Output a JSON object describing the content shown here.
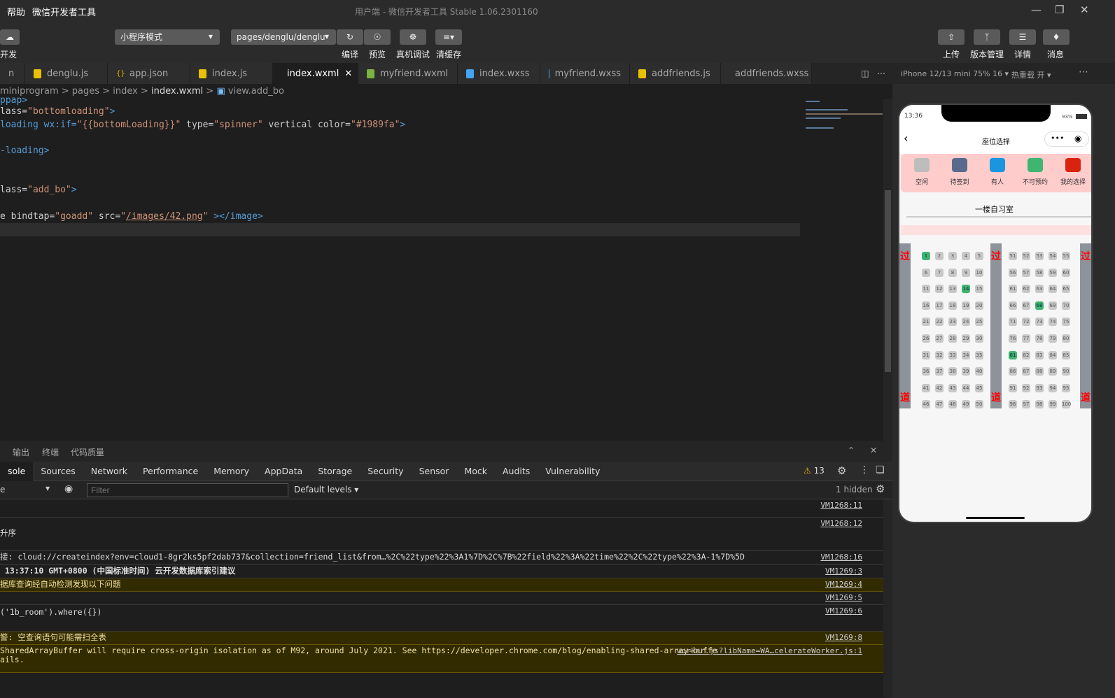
{
  "titlebar": {
    "menu": [
      "帮助",
      "微信开发者工具"
    ],
    "title": "用户端 - 微信开发者工具 Stable 1.06.2301160"
  },
  "toolbar": {
    "left_label": "开发",
    "mode": "小程序模式",
    "page_path": "pages/denglu/denglu",
    "compile": "编译",
    "preview": "预览",
    "remote_debug": "真机调试",
    "clear_cache": "清缓存",
    "upload": "上传",
    "version": "版本管理",
    "details": "详情",
    "messages": "消息"
  },
  "tabs": [
    {
      "label": "n",
      "type": "json"
    },
    {
      "label": "denglu.js",
      "type": "js"
    },
    {
      "label": "app.json",
      "type": "json"
    },
    {
      "label": "index.js",
      "type": "js"
    },
    {
      "label": "index.wxml",
      "type": "wxml",
      "active": true
    },
    {
      "label": "myfriend.wxml",
      "type": "wxml"
    },
    {
      "label": "index.wxss",
      "type": "wxss"
    },
    {
      "label": "myfriend.wxss",
      "type": "wxss"
    },
    {
      "label": "addfriends.js",
      "type": "js"
    },
    {
      "label": "addfriends.wxss",
      "type": "wxss"
    }
  ],
  "breadcrumb": [
    "miniprogram",
    "pages",
    "index",
    "index.wxml",
    "view.add_bo"
  ],
  "code": {
    "l0": "ppap>",
    "l1a": "lass=",
    "l1b": "\"bottomloading\"",
    "l1c": ">",
    "l2a": "loading wx:if=",
    "l2b": "\"{{bottomLoading}}\"",
    "l2c": " type=",
    "l2d": "\"spinner\"",
    "l2e": " vertical color=",
    "l2f": "\"#1989fa\"",
    "l2g": ">",
    "l3": "-loading>",
    "l4a": "lass=",
    "l4b": "\"add_bo\"",
    "l4c": ">",
    "l5a": "e bindtap=",
    "l5b": "\"goadd\"",
    "l5c": " src=",
    "l5d": "\"",
    "l5e": "/images/42.png",
    "l5f": "\"",
    "l5g": " ></image>"
  },
  "panel": {
    "tabs": [
      "输出",
      "终端",
      "代码质量"
    ],
    "devtools_tabs": [
      "sole",
      "Sources",
      "Network",
      "Performance",
      "Memory",
      "AppData",
      "Storage",
      "Security",
      "Sensor",
      "Mock",
      "Audits",
      "Vulnerability"
    ],
    "warnings": "13",
    "context": "e",
    "filter_placeholder": "Filter",
    "levels": "Default levels",
    "hidden": "1 hidden"
  },
  "console": [
    {
      "text": "",
      "src": "VM1268:11",
      "warn": false
    },
    {
      "text": "升序",
      "src": "VM1268:12",
      "warn": false
    },
    {
      "text": "接: cloud://createindex?env=cloud1-8gr2ks5pf2dab737&collection=friend_list&from…%2C%22type%22%3A1%7D%2C%7B%22field%22%3A%22time%22%2C%22type%22%3A-1%7D%5D",
      "src": "VM1268:16",
      "warn": false
    },
    {
      "text": " 13:37:10 GMT+0800 (中国标准时间) 云开发数据库索引建议",
      "src": "VM1269:3",
      "warn": false
    },
    {
      "text": "据库查询经自动检测发现以下问题",
      "src": "VM1269:4",
      "warn": true
    },
    {
      "text": "",
      "src": "VM1269:5",
      "warn": false
    },
    {
      "text": "('1b_room').where({})",
      "src": "VM1269:6",
      "warn": false
    },
    {
      "text": "警: 空查询语句可能需扫全表",
      "src": "VM1269:8",
      "warn": true
    },
    {
      "text": "SharedArrayBuffer will require cross-origin isolation as of M92, around July 2021. See https://developer.chrome.com/blog/enabling-shared-array-buffe\nails.",
      "src": "worker.js?libName=WA…celerateWorker.js:1",
      "warn": true
    }
  ],
  "simulator": {
    "device": "iPhone 12/13 mini 75% 16 ▾",
    "hot_reload": "热重载 开 ▾",
    "time": "13:36",
    "battery": "93%",
    "nav_title": "座位选择",
    "legend": [
      {
        "label": "空闲",
        "color": "#bdbdbd"
      },
      {
        "label": "待签到",
        "color": "#5a6a8c"
      },
      {
        "label": "有人",
        "color": "#1a96e0"
      },
      {
        "label": "不可预约",
        "color": "#3fb56f"
      },
      {
        "label": "我的选择",
        "color": "#d9230f"
      }
    ],
    "room": "一楼自习室",
    "aisle_top": "过",
    "aisle_bottom": "道",
    "seats_total": 100,
    "occupied_seats": [
      1,
      14,
      68,
      81
    ]
  }
}
